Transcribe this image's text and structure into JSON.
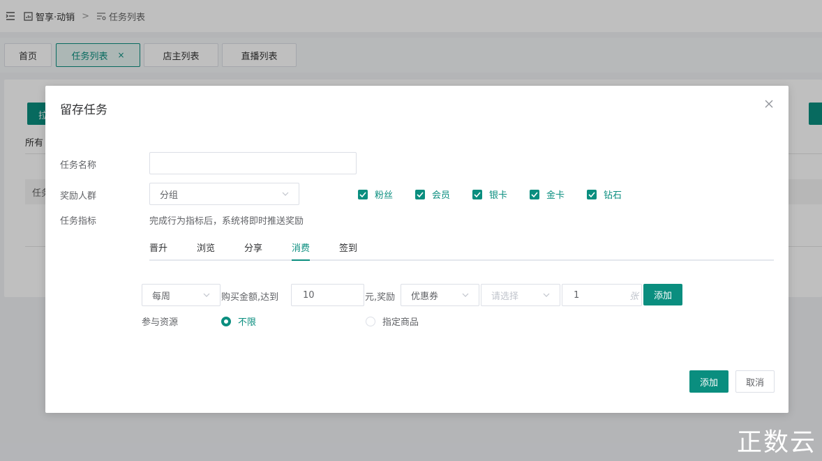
{
  "app": {
    "breadcrumb": {
      "root": "智享·动销",
      "separator": ">",
      "current": "任务列表"
    }
  },
  "tabs": [
    {
      "label": "首页"
    },
    {
      "label": "任务列表",
      "close": "×"
    },
    {
      "label": "店主列表"
    },
    {
      "label": "直播列表"
    }
  ],
  "background": {
    "left_button": "拉",
    "all_label": "所有",
    "table_header": "任务"
  },
  "modal": {
    "title": "留存任务",
    "task_name": {
      "label": "任务名称",
      "value": "",
      "placeholder": ""
    },
    "reward_group": {
      "label": "奖励人群",
      "select_value": "分组",
      "options": [
        "粉丝",
        "会员",
        "银卡",
        "金卡",
        "钻石"
      ]
    },
    "task_metric": {
      "label": "任务指标",
      "hint": "完成行为指标后，系统将即时推送奖励",
      "tabs": [
        "晋升",
        "浏览",
        "分享",
        "消费",
        "签到"
      ],
      "active_tab": "消费"
    },
    "rule": {
      "period": "每周",
      "text_buy": "购买金额,达到",
      "amount": "10",
      "text_reward": "元,奖励",
      "reward_type": "优惠券",
      "coupon_placeholder": "请选择",
      "quantity": "1",
      "quantity_unit": "张",
      "add_label": "添加"
    },
    "resource": {
      "label": "参与资源",
      "option_unlimited": "不限",
      "option_specific": "指定商品"
    },
    "footer": {
      "confirm": "添加",
      "cancel": "取消"
    }
  },
  "watermark": "正数云",
  "colors": {
    "primary": "#0a8e7f"
  }
}
